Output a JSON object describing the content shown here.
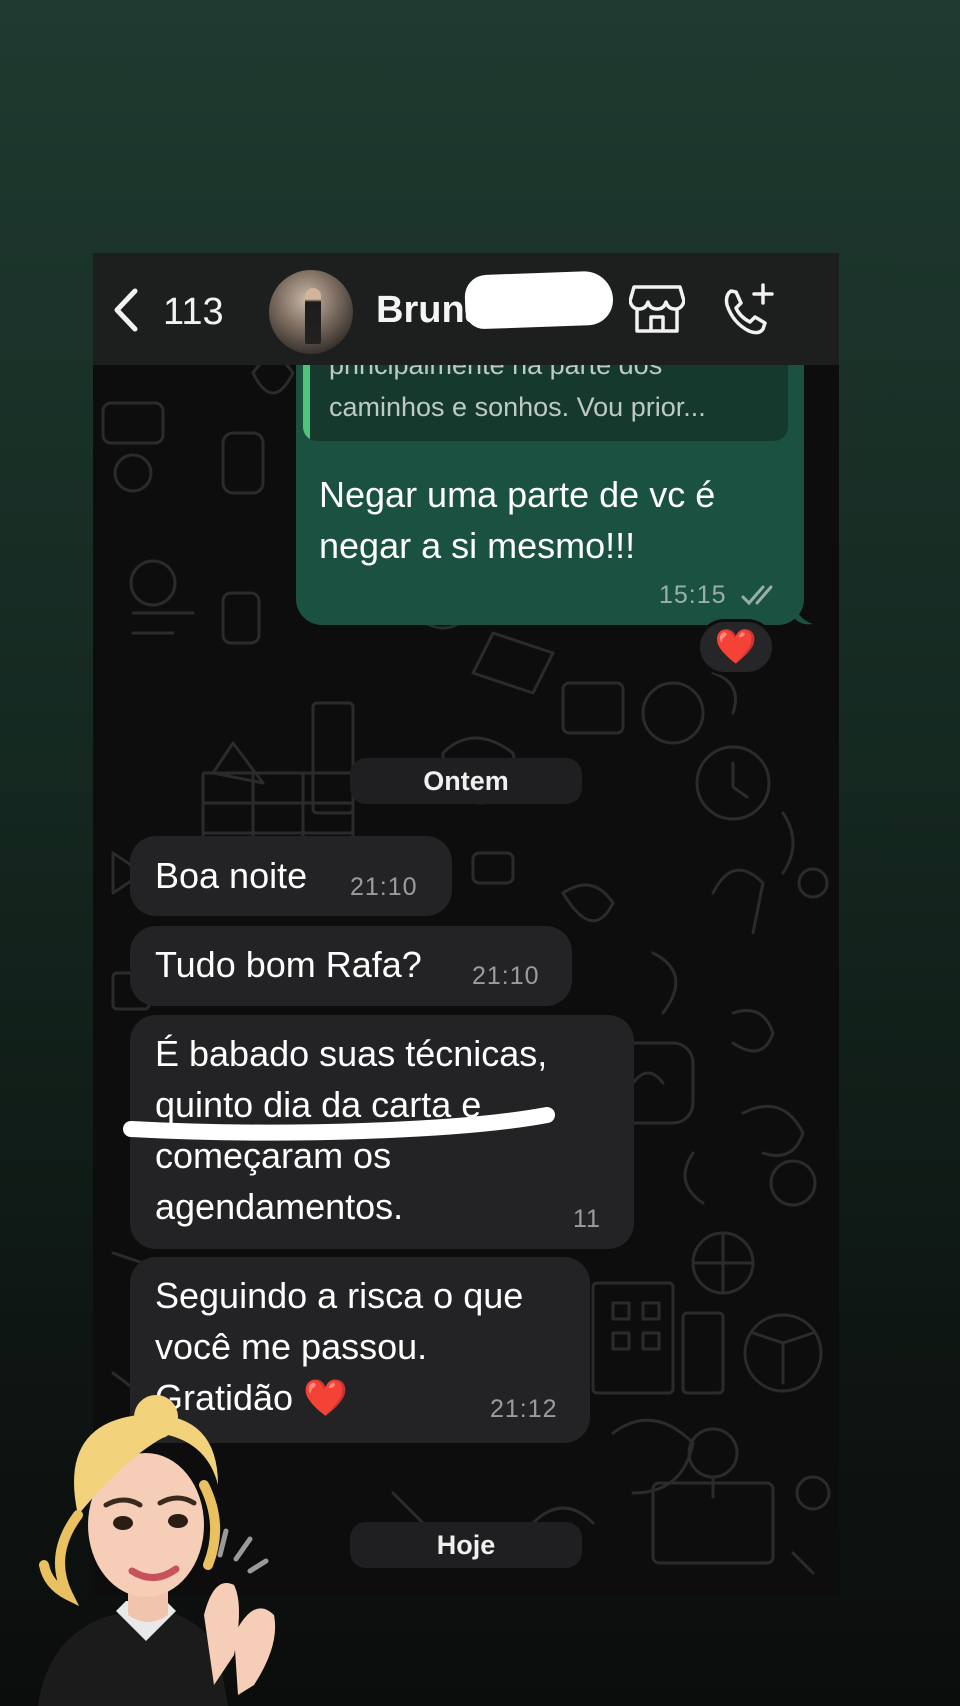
{
  "header": {
    "unread_count": "113",
    "contact_name": "Bruna",
    "icons": [
      "back-chevron-icon",
      "business-store-icon",
      "add-call-icon"
    ]
  },
  "quoted": {
    "text": "principalmente na parte dos caminhos e sonhos. Vou prior..."
  },
  "messages": [
    {
      "direction": "out",
      "text": "Negar uma parte de vc é negar a si mesmo!!!",
      "time": "15:15",
      "status": "read-double-check",
      "reaction": "❤️"
    },
    {
      "direction": "in",
      "text": "Boa noite",
      "time": "21:10"
    },
    {
      "direction": "in",
      "text": "Tudo bom Rafa?",
      "time": "21:10"
    },
    {
      "direction": "in",
      "line1": "É babado suas técnicas,",
      "line2": "quinto dia da carta e",
      "line3": "começaram os",
      "line4": "agendamentos.",
      "time_partial": "11"
    },
    {
      "direction": "in",
      "line1": "Seguindo a risca o que",
      "line2": "você me passou.",
      "line3": "Gratidão",
      "emoji": "❤️",
      "time": "21:12"
    }
  ],
  "date_dividers": {
    "yesterday": "Ontem",
    "today": "Hoje"
  },
  "colors": {
    "outgoing_bubble": "#1b5140",
    "incoming_bubble": "#232325",
    "quote_bar": "#4fc37a",
    "header_bg": "#1c1f1d"
  }
}
